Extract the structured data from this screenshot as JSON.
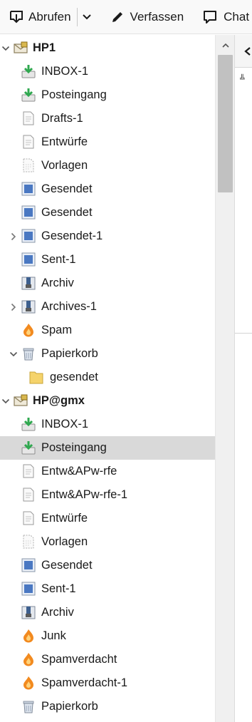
{
  "toolbar": {
    "get_messages_label": "Abrufen",
    "write_label": "Verfassen",
    "chat_label": "Chat"
  },
  "colors": {
    "selected_row": "#d9d9d9",
    "inbox_green": "#2fa84f",
    "sent_blue": "#4a78c2",
    "junk_orange": "#f28a1f",
    "folder_yellow": "#f5d36b",
    "scrollbar_thumb": "#c1c1c1"
  },
  "folders": [
    {
      "label": "HP1",
      "icon": "account-icon",
      "account": true,
      "twisty": "expanded"
    },
    {
      "label": "INBOX-1",
      "icon": "inbox-icon"
    },
    {
      "label": "Posteingang",
      "icon": "inbox-icon"
    },
    {
      "label": "Drafts-1",
      "icon": "drafts-icon"
    },
    {
      "label": "Entwürfe",
      "icon": "drafts-icon"
    },
    {
      "label": "Vorlagen",
      "icon": "templates-icon"
    },
    {
      "label": "Gesendet",
      "icon": "sent-icon"
    },
    {
      "label": "Gesendet",
      "icon": "sent-icon"
    },
    {
      "label": "Gesendet-1",
      "icon": "sent-icon",
      "twisty": "collapsed"
    },
    {
      "label": "Sent-1",
      "icon": "sent-icon"
    },
    {
      "label": "Archiv",
      "icon": "archive-icon"
    },
    {
      "label": "Archives-1",
      "icon": "archive-icon",
      "twisty": "collapsed"
    },
    {
      "label": "Spam",
      "icon": "junk-icon"
    },
    {
      "label": "Papierkorb",
      "icon": "trash-icon",
      "twisty": "expanded"
    },
    {
      "label": "gesendet",
      "icon": "folder-icon",
      "level": 2
    },
    {
      "label": "HP@gmx",
      "icon": "account-icon",
      "account": true,
      "twisty": "expanded"
    },
    {
      "label": "INBOX-1",
      "icon": "inbox-icon"
    },
    {
      "label": "Posteingang",
      "icon": "inbox-icon",
      "selected": true
    },
    {
      "label": "Entw&APw-rfe",
      "icon": "drafts-icon"
    },
    {
      "label": "Entw&APw-rfe-1",
      "icon": "drafts-icon"
    },
    {
      "label": "Entwürfe",
      "icon": "drafts-icon"
    },
    {
      "label": "Vorlagen",
      "icon": "templates-icon"
    },
    {
      "label": "Gesendet",
      "icon": "sent-icon"
    },
    {
      "label": "Sent-1",
      "icon": "sent-icon"
    },
    {
      "label": "Archiv",
      "icon": "archive-icon"
    },
    {
      "label": "Junk",
      "icon": "junk-icon"
    },
    {
      "label": "Spamverdacht",
      "icon": "junk-icon"
    },
    {
      "label": "Spamverdacht-1",
      "icon": "junk-icon"
    },
    {
      "label": "Papierkorb",
      "icon": "trash-icon"
    }
  ]
}
